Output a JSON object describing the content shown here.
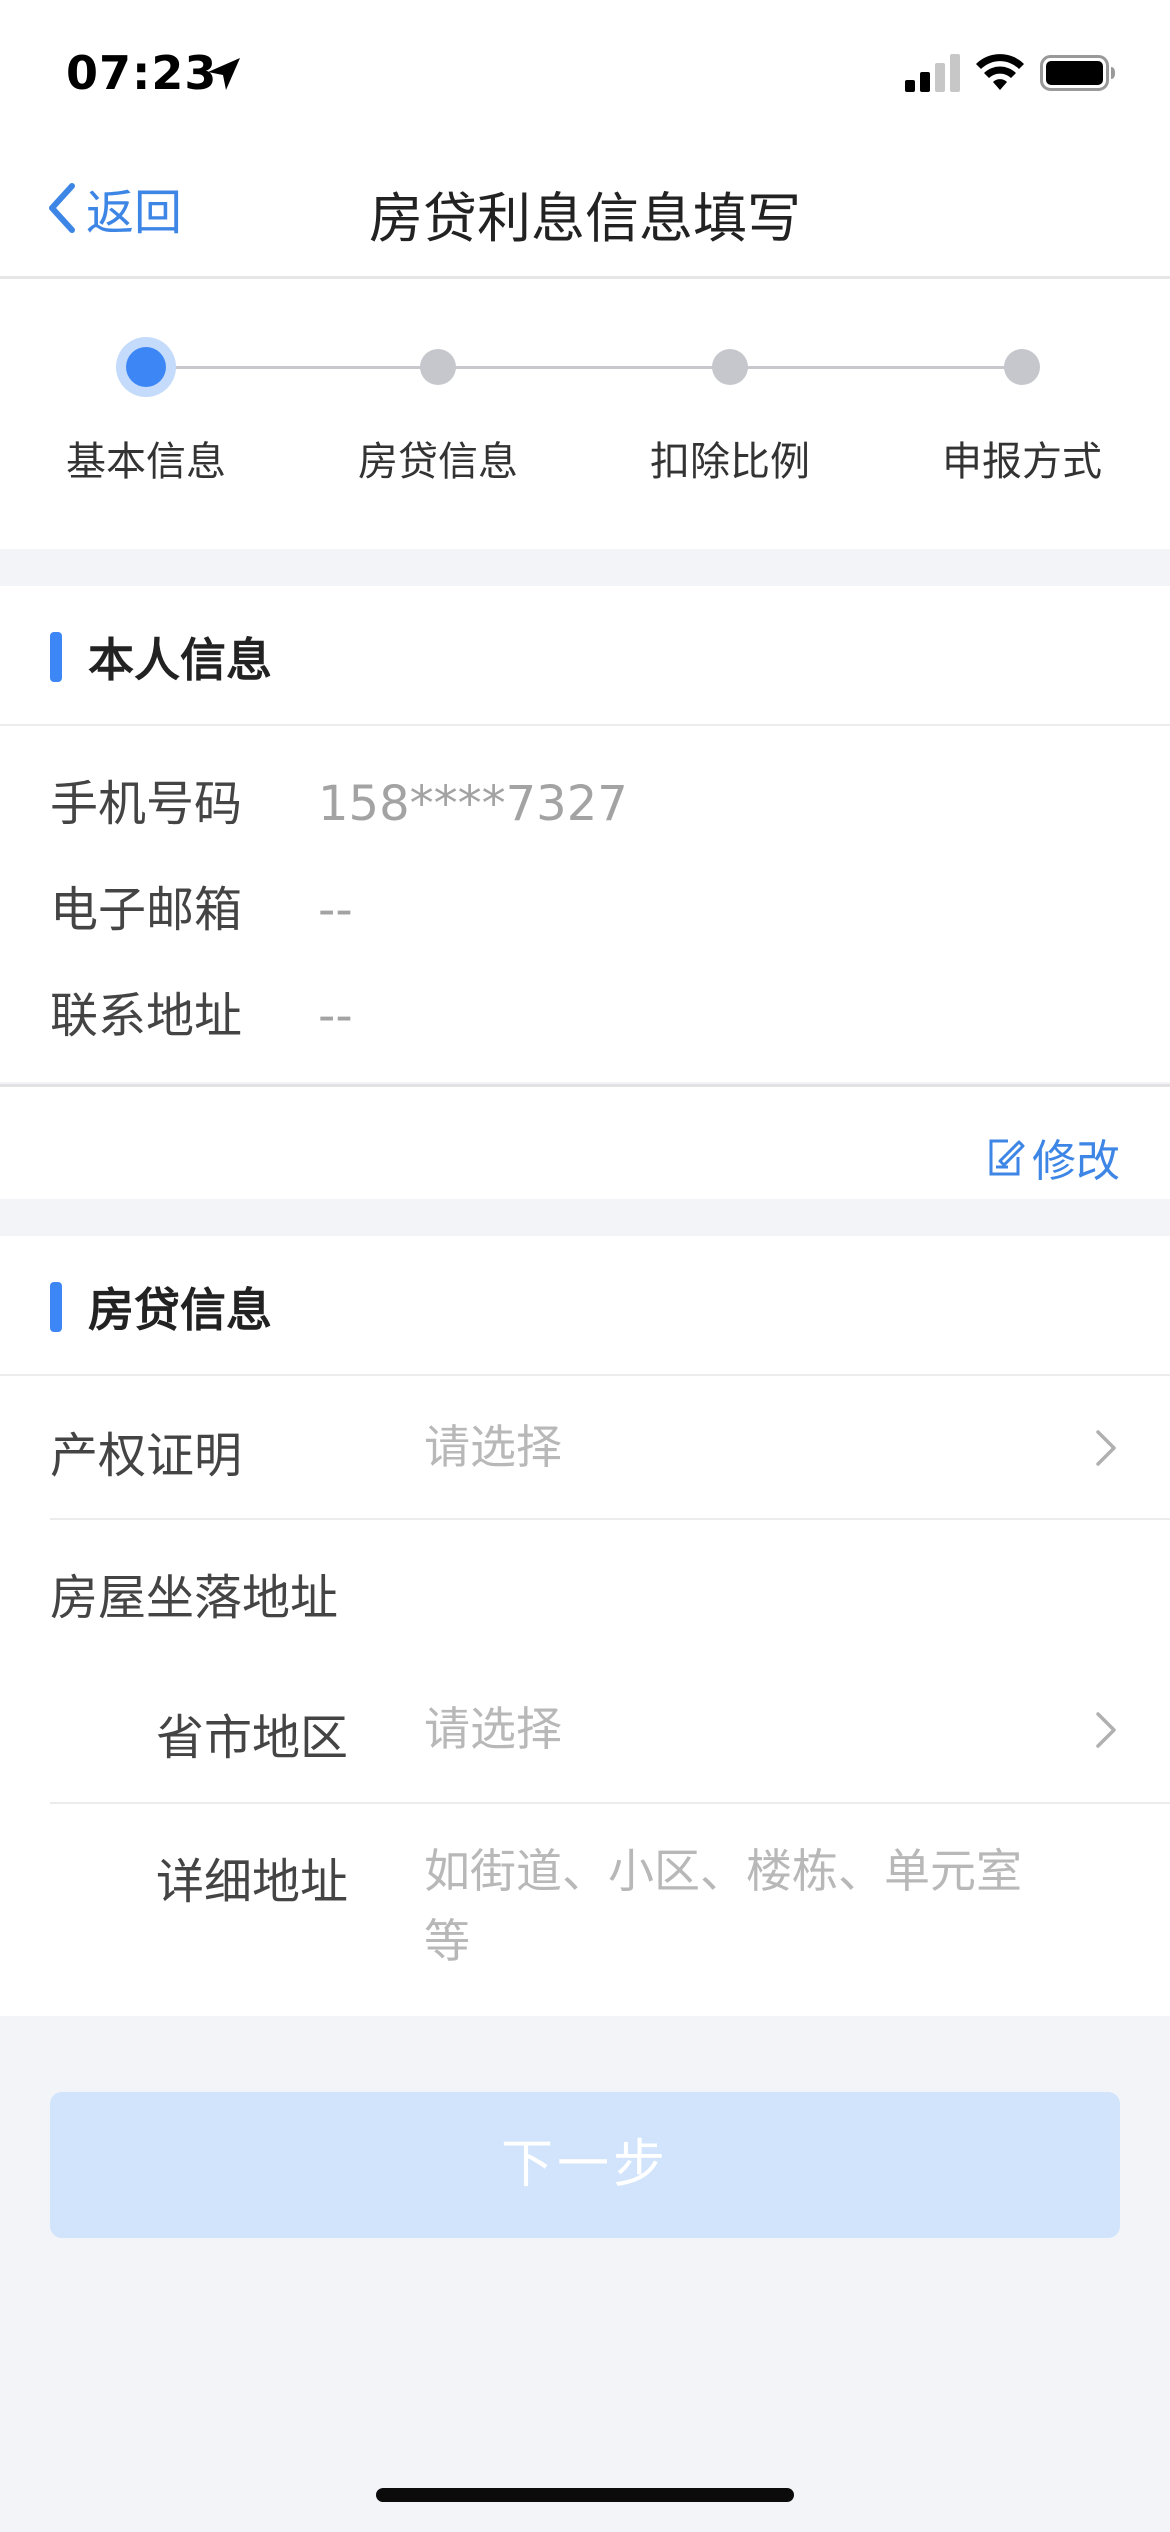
{
  "status_bar": {
    "time": "07:23"
  },
  "nav": {
    "back_label": "返回",
    "title": "房贷利息信息填写"
  },
  "steps": [
    {
      "label": "基本信息",
      "active": true
    },
    {
      "label": "房贷信息",
      "active": false
    },
    {
      "label": "扣除比例",
      "active": false
    },
    {
      "label": "申报方式",
      "active": false
    }
  ],
  "personal": {
    "title": "本人信息",
    "rows": [
      {
        "label": "手机号码",
        "value": "158****7327"
      },
      {
        "label": "电子邮箱",
        "value": "--"
      },
      {
        "label": "联系地址",
        "value": "--"
      }
    ],
    "modify_label": "修改"
  },
  "loan": {
    "title": "房贷信息",
    "property_cert": {
      "label": "产权证明",
      "placeholder": "请选择"
    },
    "house_address_label": "房屋坐落地址",
    "region": {
      "label": "省市地区",
      "placeholder": "请选择"
    },
    "detail": {
      "label": "详细地址",
      "placeholder_line1": "如街道、小区、楼栋、单元室",
      "placeholder_line2": "等"
    }
  },
  "next_button": "下一步",
  "colors": {
    "accent": "#3d86f5",
    "link": "#3d86e6",
    "disabled_button": "#d1e4fb"
  }
}
